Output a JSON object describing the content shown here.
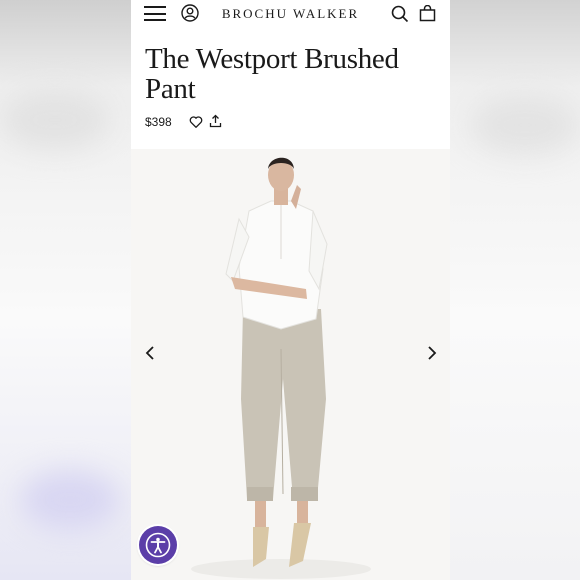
{
  "header": {
    "menu_icon": "hamburger-menu-icon",
    "account_icon": "user-account-icon",
    "brand": "BROCHU WALKER",
    "search_icon": "search-icon",
    "bag_icon": "shopping-bag-icon"
  },
  "product": {
    "title": "The Westport Brushed Pant",
    "price": "$398",
    "wishlist_icon": "heart-icon",
    "share_icon": "share-icon"
  },
  "gallery": {
    "prev_icon": "chevron-left-icon",
    "next_icon": "chevron-right-icon",
    "image_subject": "model wearing white shirt and grey brushed pants"
  },
  "accessibility": {
    "icon": "accessibility-icon",
    "color": "#5b3ea8"
  }
}
